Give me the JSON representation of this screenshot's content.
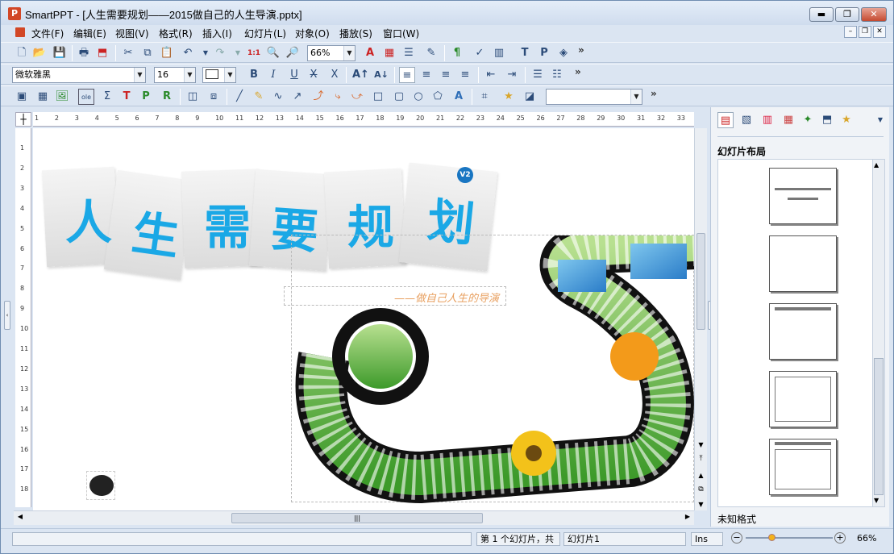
{
  "window": {
    "app_name": "SmartPPT",
    "title": "SmartPPT - [人生需要规划——2015做自己的人生导演.pptx]",
    "icon_letter": "P",
    "minimize": "▬",
    "maximize": "❐",
    "close": "✕"
  },
  "menu": [
    "文件(F)",
    "编辑(E)",
    "视图(V)",
    "格式(R)",
    "插入(I)",
    "幻灯片(L)",
    "对象(O)",
    "播放(S)",
    "窗口(W)"
  ],
  "mdi_controls": [
    "–",
    "❐",
    "✕"
  ],
  "toolbar1": {
    "zoom_value": "66%",
    "more": "»"
  },
  "toolbar2": {
    "font_name": "微软雅黑",
    "font_size": "16",
    "more": "»"
  },
  "toolbar3": {
    "more": "»"
  },
  "ruler": {
    "h_ticks": [
      "1",
      "2",
      "3",
      "4",
      "5",
      "6",
      "7",
      "8",
      "9",
      "10",
      "11",
      "12",
      "13",
      "14",
      "15",
      "16",
      "17",
      "18",
      "19",
      "20",
      "21",
      "22",
      "23",
      "24",
      "25",
      "26",
      "27",
      "28",
      "29",
      "30",
      "31",
      "32",
      "33"
    ],
    "v_ticks": [
      "1",
      "2",
      "3",
      "4",
      "5",
      "6",
      "7",
      "8",
      "9",
      "10",
      "11",
      "12",
      "13",
      "14",
      "15",
      "16",
      "17",
      "18"
    ]
  },
  "slide": {
    "headline_chars": [
      "人",
      "生",
      "需",
      "要",
      "规",
      "划"
    ],
    "badge": "V2",
    "subtitle": "——做自己人生的导演"
  },
  "right_panel": {
    "section_title": "幻灯片布局",
    "footer_label": "未知格式"
  },
  "statusbar": {
    "slide_info": "第 1 个幻灯片，共",
    "slide_name": "幻灯片1",
    "mode": "Ins",
    "zoom": "66%"
  },
  "colors": {
    "headline": "#1aa8e6",
    "subtitle": "#e8a060",
    "badge": "#1976c2"
  }
}
